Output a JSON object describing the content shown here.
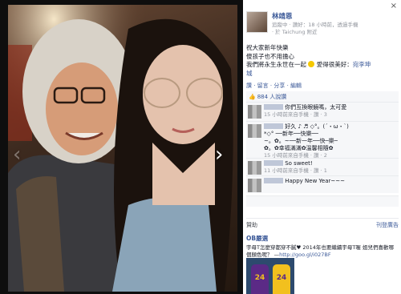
{
  "photo_viewer": {
    "prev_icon": "chevron-left-icon",
    "next_icon": "chevron-right-icon",
    "prev_glyph": "‹",
    "next_glyph": "›"
  },
  "post": {
    "author": "林靖恩",
    "meta": "追蹤中 · 讚好：18 小時前，透過手機",
    "location": "· 於 Taichung 附近",
    "caption_lines": [
      "祝大家新年快樂",
      "傻孩子也不用擔心",
      "我們將永生永世在一起"
    ],
    "caption_love": "愛得很美好：",
    "caption_link1": "宛李坤",
    "caption_link2": "城",
    "actions": "讚 · 留言 · 分享 · 編輯",
    "likes": "884 人說讚",
    "close_glyph": "×"
  },
  "comments": [
    {
      "text": "你們互換眼鏡嗎，太可愛",
      "meta": "15 小時前來自手機 · 讚 · 3"
    },
    {
      "lines": [
        "好久 ♪ ♬ ◇°。(´・ω・`)",
        "*◇° ──新年──快樂──",
        "~。✿。~──新一年──快─樂─",
        "✿。✿幸福滿滿✿溫馨相隨✿"
      ],
      "meta": "15 小時前來自手機 · 讚 · 2"
    },
    {
      "text": "So sweet!",
      "meta": "11 小時前來自手機 · 讚 · 1"
    },
    {
      "text": "Happy New Year~~~",
      "meta": "11 小時前來自手機 · 讚 · 1"
    }
  ],
  "sponsor": {
    "label": "贊助",
    "create_ad": "刊登廣告",
    "brand": "OB嚴選",
    "text": "宇母T怎麼穿都穿不膩♥ 2014年也要繼續宇母T喔 姐兒們喜歡哪個顏色呢？ —",
    "link": "http://goo.gl/i027BF"
  },
  "colors": {
    "link": "#3b5998",
    "muted": "#90949c",
    "comment_bg": "#f6f7f9"
  }
}
